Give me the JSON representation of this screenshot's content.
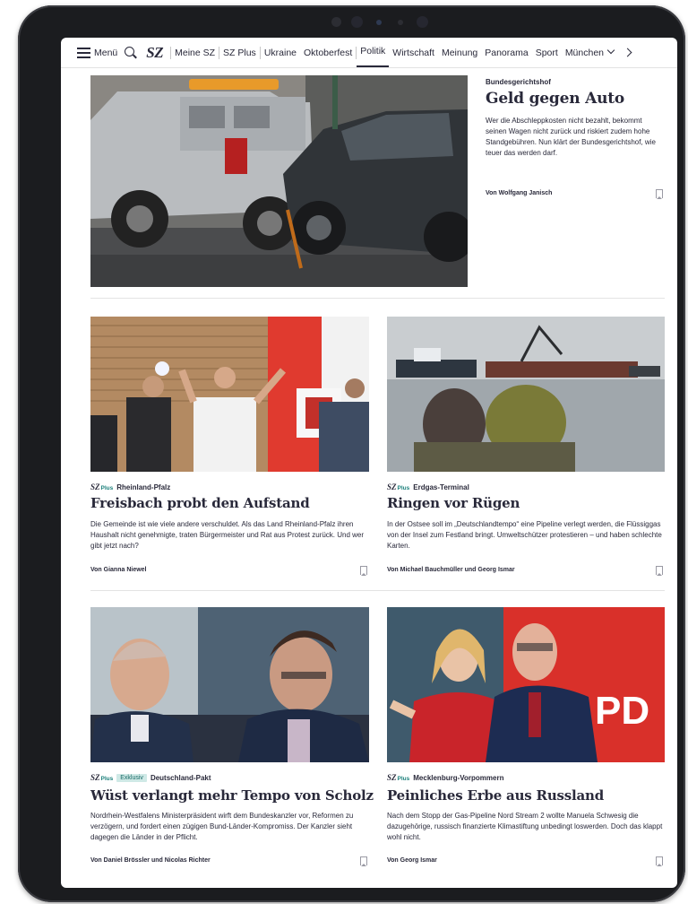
{
  "nav": {
    "menu_label": "Menü",
    "logo": "SZ",
    "items": [
      "Meine SZ",
      "SZ Plus",
      "Ukraine",
      "Oktoberfest",
      "Politik",
      "Wirtschaft",
      "Meinung",
      "Panorama",
      "Sport",
      "München"
    ],
    "active": "Politik"
  },
  "articles": [
    {
      "kicker": "Bundesgerichtshof",
      "headline": "Geld gegen Auto",
      "teaser": "Wer die Abschleppkosten nicht bezahlt, bekommt seinen Wagen nicht zurück und riskiert zudem hohe Standgebühren. Nun klärt der Bundesgerichtshof, wie teuer das werden darf.",
      "author": "Von Wolfgang Janisch",
      "plus": false,
      "badge": ""
    },
    {
      "kicker": "Rheinland-Pfalz",
      "headline": "Freisbach probt den Aufstand",
      "teaser": "Die Gemeinde ist wie viele andere verschuldet. Als das Land Rheinland-Pfalz ihren Haushalt nicht genehmigte, traten Bürgermeister und Rat aus Protest zurück. Und wer gibt jetzt nach?",
      "author": "Von Gianna Niewel",
      "plus": true,
      "badge": ""
    },
    {
      "kicker": "Erdgas-Terminal",
      "headline": "Ringen vor Rügen",
      "teaser": "In der Ostsee soll im „Deutschlandtempo“ eine Pipeline verlegt werden, die Flüssiggas von der Insel zum Festland bringt. Umweltschützer protestieren – und haben schlechte Karten.",
      "author": "Von Michael Bauchmüller und Georg Ismar",
      "plus": true,
      "badge": ""
    },
    {
      "kicker": "Deutschland-Pakt",
      "headline": "Wüst verlangt mehr Tempo von Scholz",
      "teaser": "Nordrhein-Westfalens Ministerpräsident wirft dem Bundeskanzler vor, Reformen zu verzögern, und fordert einen zügigen Bund-Länder-Kompromiss. Der Kanzler sieht dagegen die Länder in der Pflicht.",
      "author": "Von Daniel Brössler und Nicolas Richter",
      "plus": true,
      "badge": "Exklusiv"
    },
    {
      "kicker": "Mecklenburg-Vorpommern",
      "headline": "Peinliches Erbe aus Russland",
      "teaser": "Nach dem Stopp der Gas-Pipeline Nord Stream 2 wollte Manuela Schwesig die dazugehörige, russisch finanzierte Klimastiftung unbedingt loswerden. Doch das klappt wohl nicht.",
      "author": "Von Georg Ismar",
      "plus": true,
      "badge": ""
    }
  ],
  "sz_plus": {
    "sz": "SZ",
    "plus": "Plus"
  },
  "photo_text": {
    "spd_sign": "PD"
  }
}
